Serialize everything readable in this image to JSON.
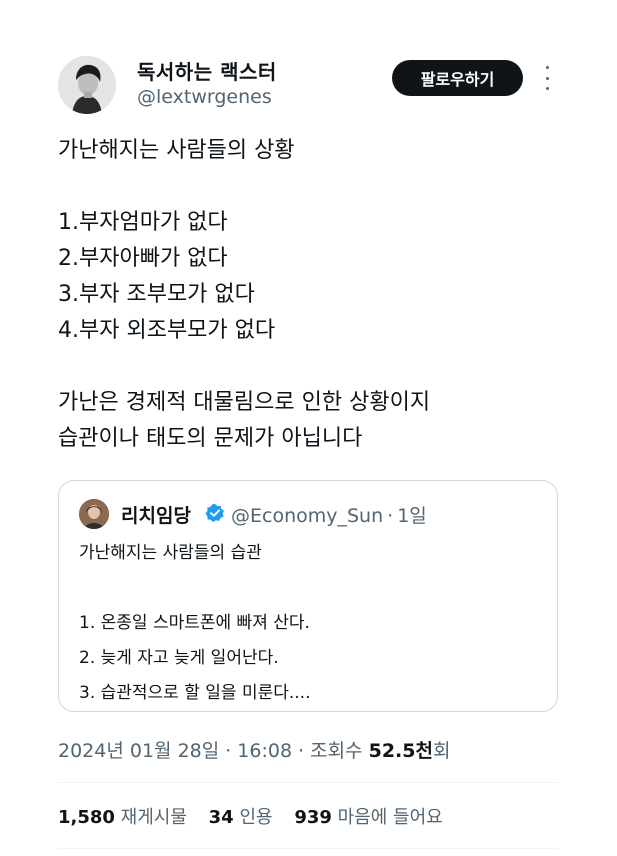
{
  "author": {
    "display_name": "독서하는 랙스터",
    "handle": "@lextwrgenes"
  },
  "follow_label": "팔로우하기",
  "tweet": {
    "lines": [
      "가난해지는 사람들의 상황",
      "",
      "1.부자엄마가 없다",
      "2.부자아빠가 없다",
      "3.부자 조부모가 없다",
      "4.부자 외조부모가 없다",
      "",
      "가난은 경제적 대물림으로 인한 상황이지",
      "습관이나 태도의 문제가 아닙니다"
    ]
  },
  "quote": {
    "name": "리치임당",
    "handle": "@Economy_Sun",
    "time": "1일",
    "lines": [
      "가난해지는 사람들의 습관",
      "",
      "1. 온종일 스마트폰에 빠져 산다.",
      "2. 늦게 자고 늦게 일어난다.",
      "3. 습관적으로 할 일을 미룬다...."
    ],
    "verified_color": "#1d9bf0"
  },
  "meta": {
    "date": "2024년 01월 28일",
    "time": "16:08",
    "views_label": "조회수",
    "views_count": "52.5천",
    "views_suffix": "회"
  },
  "stats": {
    "reposts_count": "1,580",
    "reposts_label": "재게시물",
    "quotes_count": "34",
    "quotes_label": "인용",
    "likes_count": "939",
    "likes_label": "마음에 들어요"
  }
}
